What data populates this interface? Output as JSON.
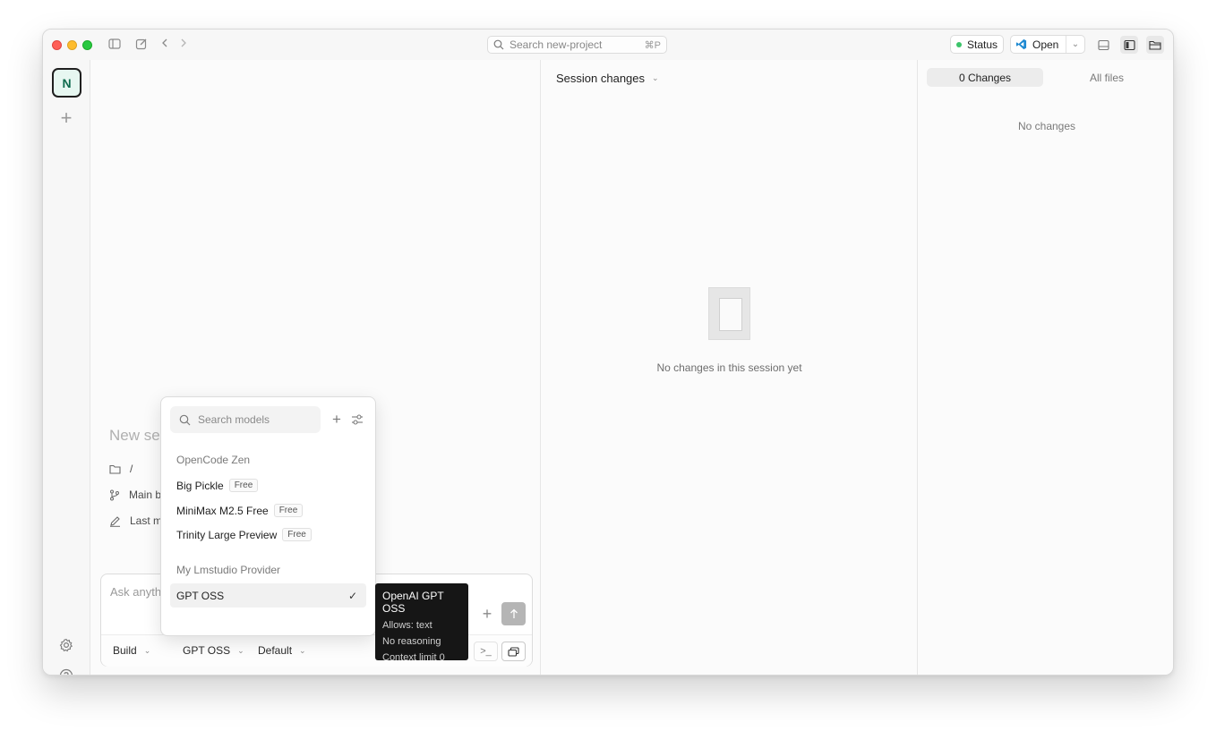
{
  "titlebar": {
    "search_placeholder": "Search new-project",
    "search_shortcut": "⌘P",
    "status_label": "Status",
    "open_label": "Open"
  },
  "rail": {
    "project_initial": "N"
  },
  "session": {
    "title_placeholder": "New se",
    "directory": "/",
    "branch": "Main b",
    "last_modified": "Last m",
    "composer_placeholder": "Ask anythi",
    "mode_label": "Build",
    "model_label": "GPT OSS",
    "variant_label": "Default"
  },
  "changes": {
    "header_label": "Session changes",
    "empty_message": "No changes in this session yet"
  },
  "files": {
    "tab_changes": "0 Changes",
    "tab_all_files": "All files",
    "empty_message": "No changes"
  },
  "model_picker": {
    "search_placeholder": "Search models",
    "groups": [
      {
        "name": "OpenCode Zen",
        "items": [
          {
            "label": "Big Pickle",
            "badge": "Free"
          },
          {
            "label": "MiniMax M2.5 Free",
            "badge": "Free"
          },
          {
            "label": "Trinity Large Preview",
            "badge": "Free"
          }
        ]
      },
      {
        "name": "My Lmstudio Provider",
        "items": [
          {
            "label": "GPT OSS",
            "selected": true,
            "check": "✓"
          }
        ]
      }
    ]
  },
  "tooltip": {
    "title": "OpenAI GPT OSS",
    "allows": "Allows: text",
    "reasoning": "No reasoning",
    "context": "Context limit 0"
  },
  "colors": {
    "status_dot": "#3cc46a",
    "avatar_bg": "#e7f7f1",
    "avatar_text": "#0e6b4e",
    "tooltip_bg": "#161616"
  }
}
